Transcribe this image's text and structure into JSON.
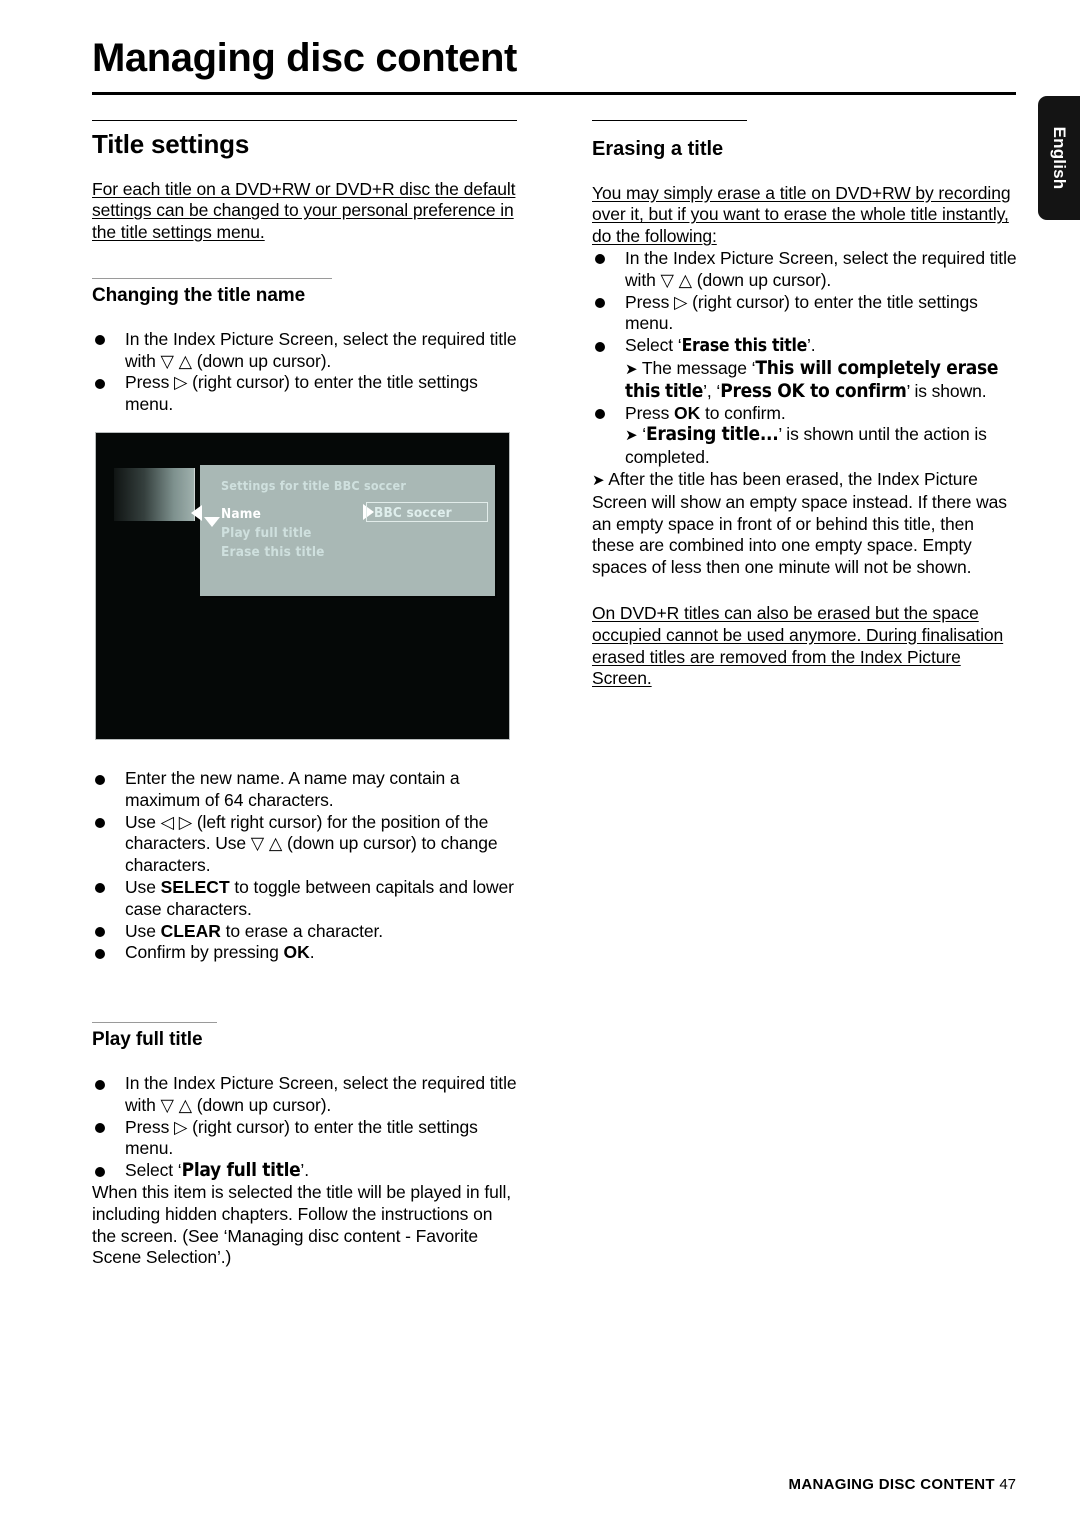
{
  "page": {
    "title": "Managing disc content",
    "language_tab": "English",
    "footer_section": "MANAGING DISC CONTENT",
    "footer_page": "47"
  },
  "left_column": {
    "section_heading": "Title settings",
    "intro": "For each title on a DVD+RW or DVD+R disc the default settings can be changed to your personal preference in the title settings menu.",
    "sub1": {
      "heading": "Changing the title name",
      "bullets": [
        "In the Index Picture Screen, select the required title with ▽ △ (down up cursor).",
        "Press ▷ (right cursor) to enter the title settings menu."
      ],
      "bullets_after_image": [
        "Enter the new name. A name may contain a maximum of 64 characters.",
        "Use ◁ ▷ (left right cursor) for the position of the characters. Use ▽ △ (down up cursor) to change characters.",
        "Use SELECT to toggle between capitals and lower case characters.",
        "Use CLEAR to erase a character.",
        "Confirm by pressing OK."
      ]
    },
    "sub2": {
      "heading": "Play full title",
      "bullets": [
        "In the Index Picture Screen, select the required title with ▽ △ (down up cursor).",
        "Press ▷ (right cursor) to enter the title settings menu.",
        "Select ‘Play full title’."
      ],
      "closing": "When this item is selected the title will be played in full, including hidden chapters. Follow the instructions on the screen. (See ‘Managing disc content - Favorite Scene Selection’.)"
    }
  },
  "right_column": {
    "section_heading": "Erasing a title",
    "intro": "You may simply erase a title on DVD+RW by recording over it, but if you want to erase the whole title instantly, do the following:",
    "bullets": [
      "In the Index Picture Screen, select the required title with ▽ △ (down up cursor).",
      "Press ▷ (right cursor) to enter the title settings menu.",
      "Select ‘Erase this title’.",
      "Press OK to confirm."
    ],
    "results": [
      "The message ‘This will completely erase this title’, ‘Press OK to confirm’ is shown.",
      "‘Erasing title...’ is shown until the action is completed.",
      "After the title has been erased, the Index Picture Screen will show an empty space instead. If there was an empty space in front of or behind this title, then these are combined into one empty space. Empty spaces of less then one minute will not be shown."
    ],
    "closing": "On DVD+R titles can also be erased but the space occupied cannot be used anymore. During finalisation erased titles are removed from the Index Picture Screen."
  },
  "tv_screenshot": {
    "menu_heading": "Settings for title BBC soccer",
    "items": [
      "Name",
      "Play full title",
      "Erase this title"
    ],
    "selected_item": "Name",
    "value": "BBC soccer",
    "screen_bg": "#050807",
    "panel_bg": "#a9b8b5",
    "text_color": "#cfe0de",
    "selected_color": "#ffffff"
  },
  "osd_terms": {
    "erase_this_title": "Erase this title",
    "play_full_title": "Play full title",
    "msg_line1": "This will completely erase this",
    "msg_line2": "title",
    "msg_line3": "Press OK to confirm",
    "erasing_title": "Erasing title..."
  },
  "keys": {
    "select": "SELECT",
    "clear": "CLEAR",
    "ok": "OK"
  }
}
